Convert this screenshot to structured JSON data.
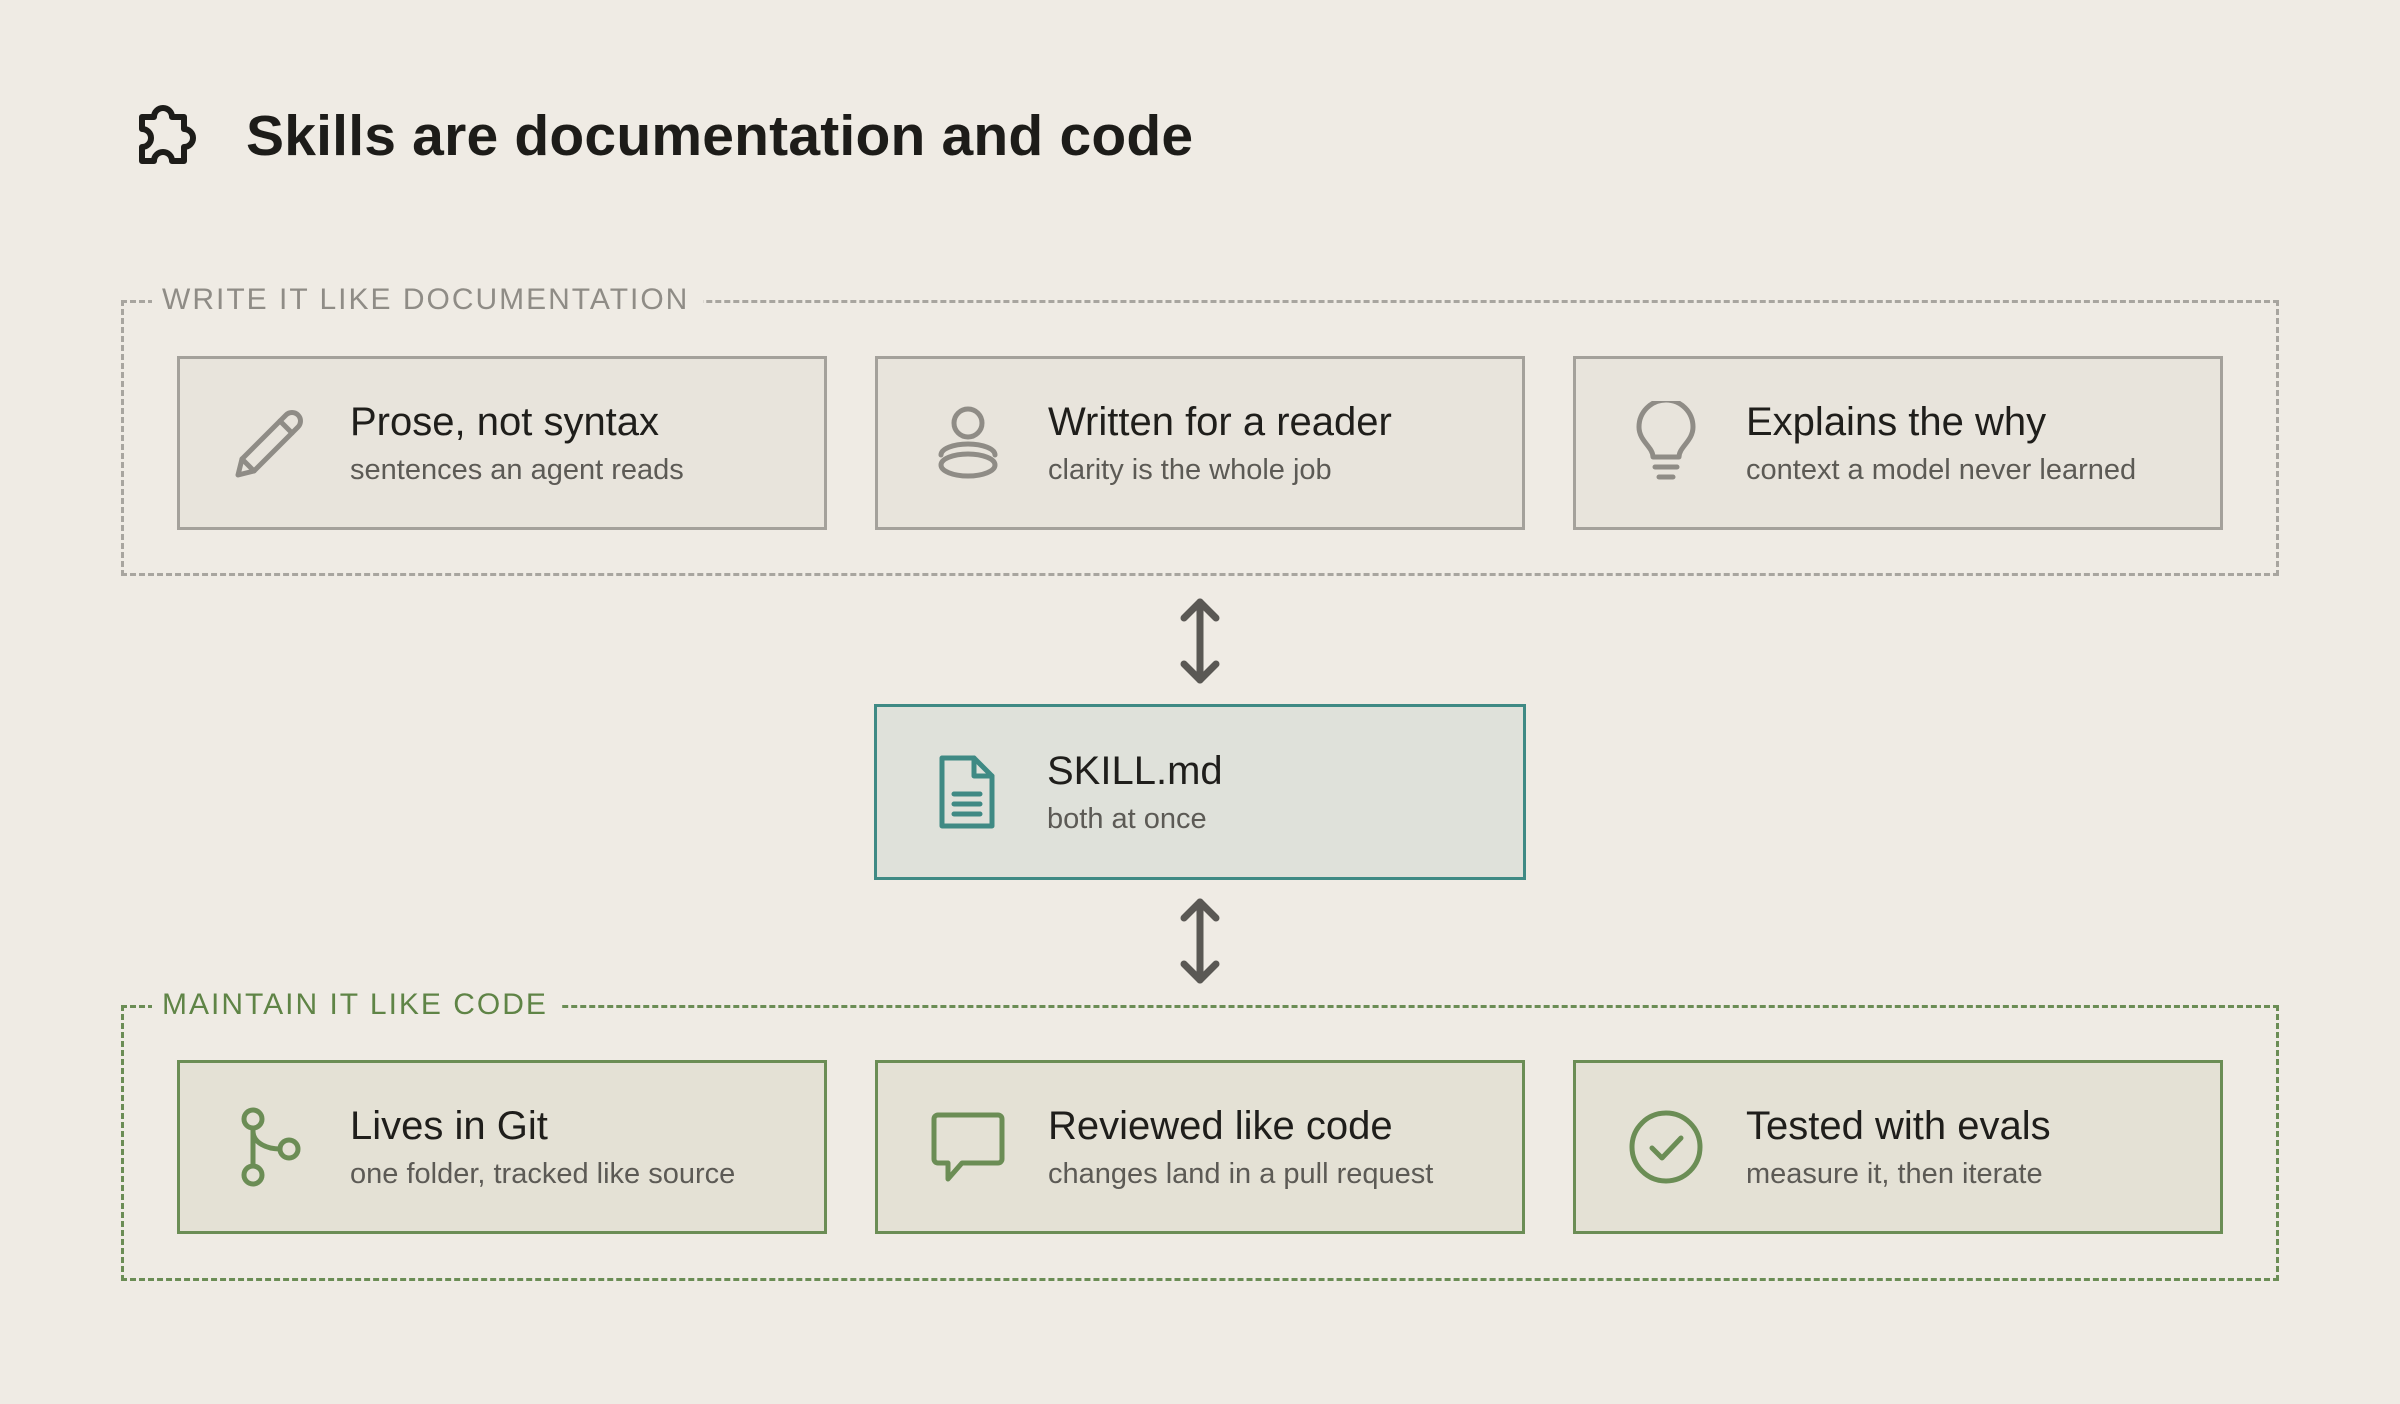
{
  "header": {
    "title": "Skills are documentation and code",
    "icon": "puzzle-icon"
  },
  "documentation_group": {
    "label": "WRITE IT LIKE DOCUMENTATION",
    "items": [
      {
        "icon": "pencil-icon",
        "title": "Prose, not syntax",
        "subtitle": "sentences an agent reads"
      },
      {
        "icon": "person-icon",
        "title": "Written for a reader",
        "subtitle": "clarity is the whole job"
      },
      {
        "icon": "lightbulb-icon",
        "title": "Explains the why",
        "subtitle": "context a model never learned"
      }
    ]
  },
  "center": {
    "icon": "document-icon",
    "title": "SKILL.md",
    "subtitle": "both at once"
  },
  "code_group": {
    "label": "MAINTAIN IT LIKE CODE",
    "items": [
      {
        "icon": "git-branch-icon",
        "title": "Lives in Git",
        "subtitle": "one folder, tracked like source"
      },
      {
        "icon": "speech-bubble-icon",
        "title": "Reviewed like code",
        "subtitle": "changes land in a pull request"
      },
      {
        "icon": "check-circle-icon",
        "title": "Tested with evals",
        "subtitle": "measure it, then iterate"
      }
    ]
  },
  "colors": {
    "background": "#efebe4",
    "doc_border": "#a4a19b",
    "code_border": "#6b8d55",
    "center_border": "#3f8a84",
    "arrow": "#5a5854"
  }
}
